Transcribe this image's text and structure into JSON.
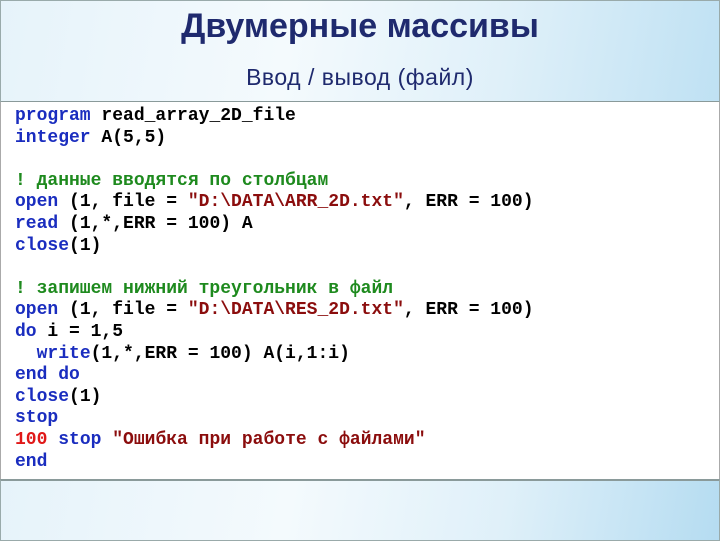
{
  "slide": {
    "title": "Двумерные массивы",
    "subtitle": "Ввод / вывод  (файл)"
  },
  "colors": {
    "keyword": "#1a2dbf",
    "comment": "#1e8a1e",
    "string": "#8b0d0d",
    "label": "#e01818",
    "title": "#1f2a6e"
  },
  "code": [
    [
      {
        "t": "program",
        "c": "kw"
      },
      {
        "t": " read_array_2D_file",
        "c": "tx"
      }
    ],
    [
      {
        "t": "integer",
        "c": "kw"
      },
      {
        "t": " A(5,5)",
        "c": "tx"
      }
    ],
    [],
    [
      {
        "t": "! данные вводятся по столбцам",
        "c": "cm"
      }
    ],
    [
      {
        "t": "open",
        "c": "kw"
      },
      {
        "t": " (1, file = ",
        "c": "tx"
      },
      {
        "t": "\"D:\\DATA\\ARR_2D.txt\"",
        "c": "str"
      },
      {
        "t": ", ERR = 100)",
        "c": "tx"
      }
    ],
    [
      {
        "t": "read",
        "c": "kw"
      },
      {
        "t": " (1,*,ERR = 100) A",
        "c": "tx"
      }
    ],
    [
      {
        "t": "close",
        "c": "kw"
      },
      {
        "t": "(1)",
        "c": "tx"
      }
    ],
    [],
    [
      {
        "t": "! запишем нижний треугольник в файл",
        "c": "cm"
      }
    ],
    [
      {
        "t": "open",
        "c": "kw"
      },
      {
        "t": " (1, file = ",
        "c": "tx"
      },
      {
        "t": "\"D:\\DATA\\RES_2D.txt\"",
        "c": "str"
      },
      {
        "t": ", ERR = 100)",
        "c": "tx"
      }
    ],
    [
      {
        "t": "do",
        "c": "kw"
      },
      {
        "t": " i = 1,5",
        "c": "tx"
      }
    ],
    [
      {
        "t": "  ",
        "c": "tx"
      },
      {
        "t": "write",
        "c": "kw"
      },
      {
        "t": "(1,*,ERR = 100) A(i,1:i)",
        "c": "tx"
      }
    ],
    [
      {
        "t": "end do",
        "c": "kw"
      }
    ],
    [
      {
        "t": "close",
        "c": "kw"
      },
      {
        "t": "(1)",
        "c": "tx"
      }
    ],
    [
      {
        "t": "stop",
        "c": "kw"
      }
    ],
    [
      {
        "t": "100",
        "c": "lbl"
      },
      {
        "t": " ",
        "c": "tx"
      },
      {
        "t": "stop",
        "c": "kw"
      },
      {
        "t": " ",
        "c": "tx"
      },
      {
        "t": "\"Ошибка при работе с файлами\"",
        "c": "str"
      }
    ],
    [
      {
        "t": "end",
        "c": "kw"
      }
    ]
  ]
}
